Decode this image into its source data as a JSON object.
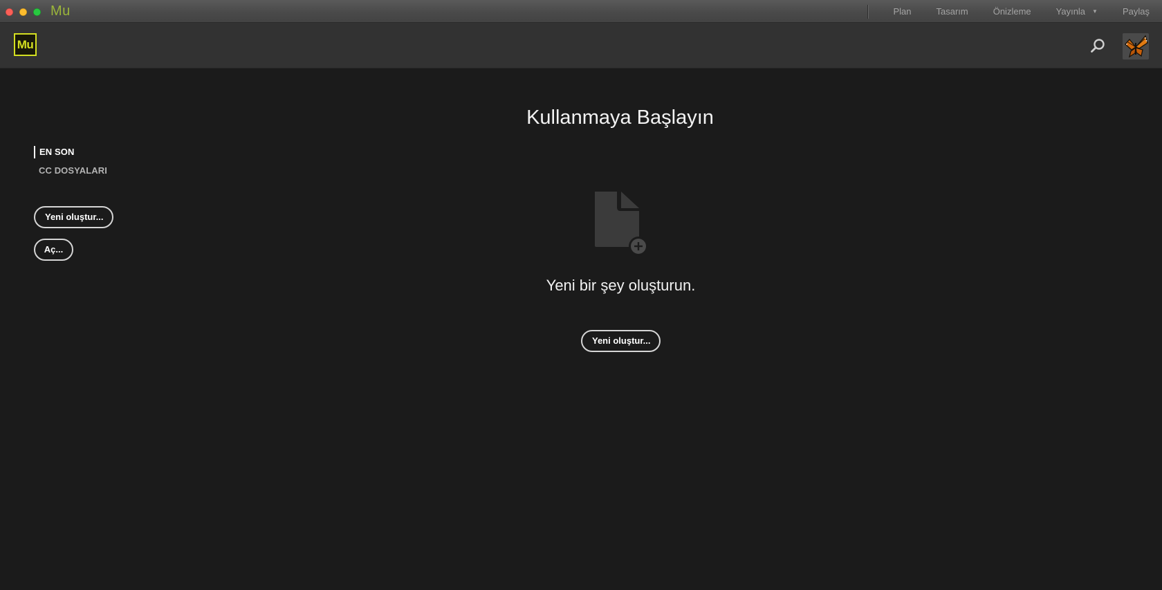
{
  "window": {
    "app_title": "Mu",
    "modes": [
      {
        "label": "Plan"
      },
      {
        "label": "Tasarım"
      },
      {
        "label": "Önizleme"
      },
      {
        "label": "Yayınla"
      },
      {
        "label": "Paylaş"
      }
    ]
  },
  "header": {
    "logo_text": "Mu",
    "search_icon": "search-icon",
    "avatar_icon": "butterfly-avatar"
  },
  "sidebar": {
    "tabs": [
      {
        "label": "EN SON",
        "active": true
      },
      {
        "label": "CC DOSYALARI",
        "active": false
      }
    ],
    "new_button": "Yeni oluştur...",
    "open_button": "Aç..."
  },
  "main": {
    "title": "Kullanmaya Başlayın",
    "empty_icon": "new-document-plus-icon",
    "empty_message": "Yeni bir şey oluşturun.",
    "new_button": "Yeni oluştur..."
  },
  "colors": {
    "background": "#1b1b1b",
    "header": "#323232",
    "titlebar": "#4a4a4a",
    "brand_accent": "#d4e021",
    "app_title": "#9bb53a",
    "close": "#fc5f57",
    "minimize": "#fdbc2e",
    "maximize": "#28c840"
  }
}
